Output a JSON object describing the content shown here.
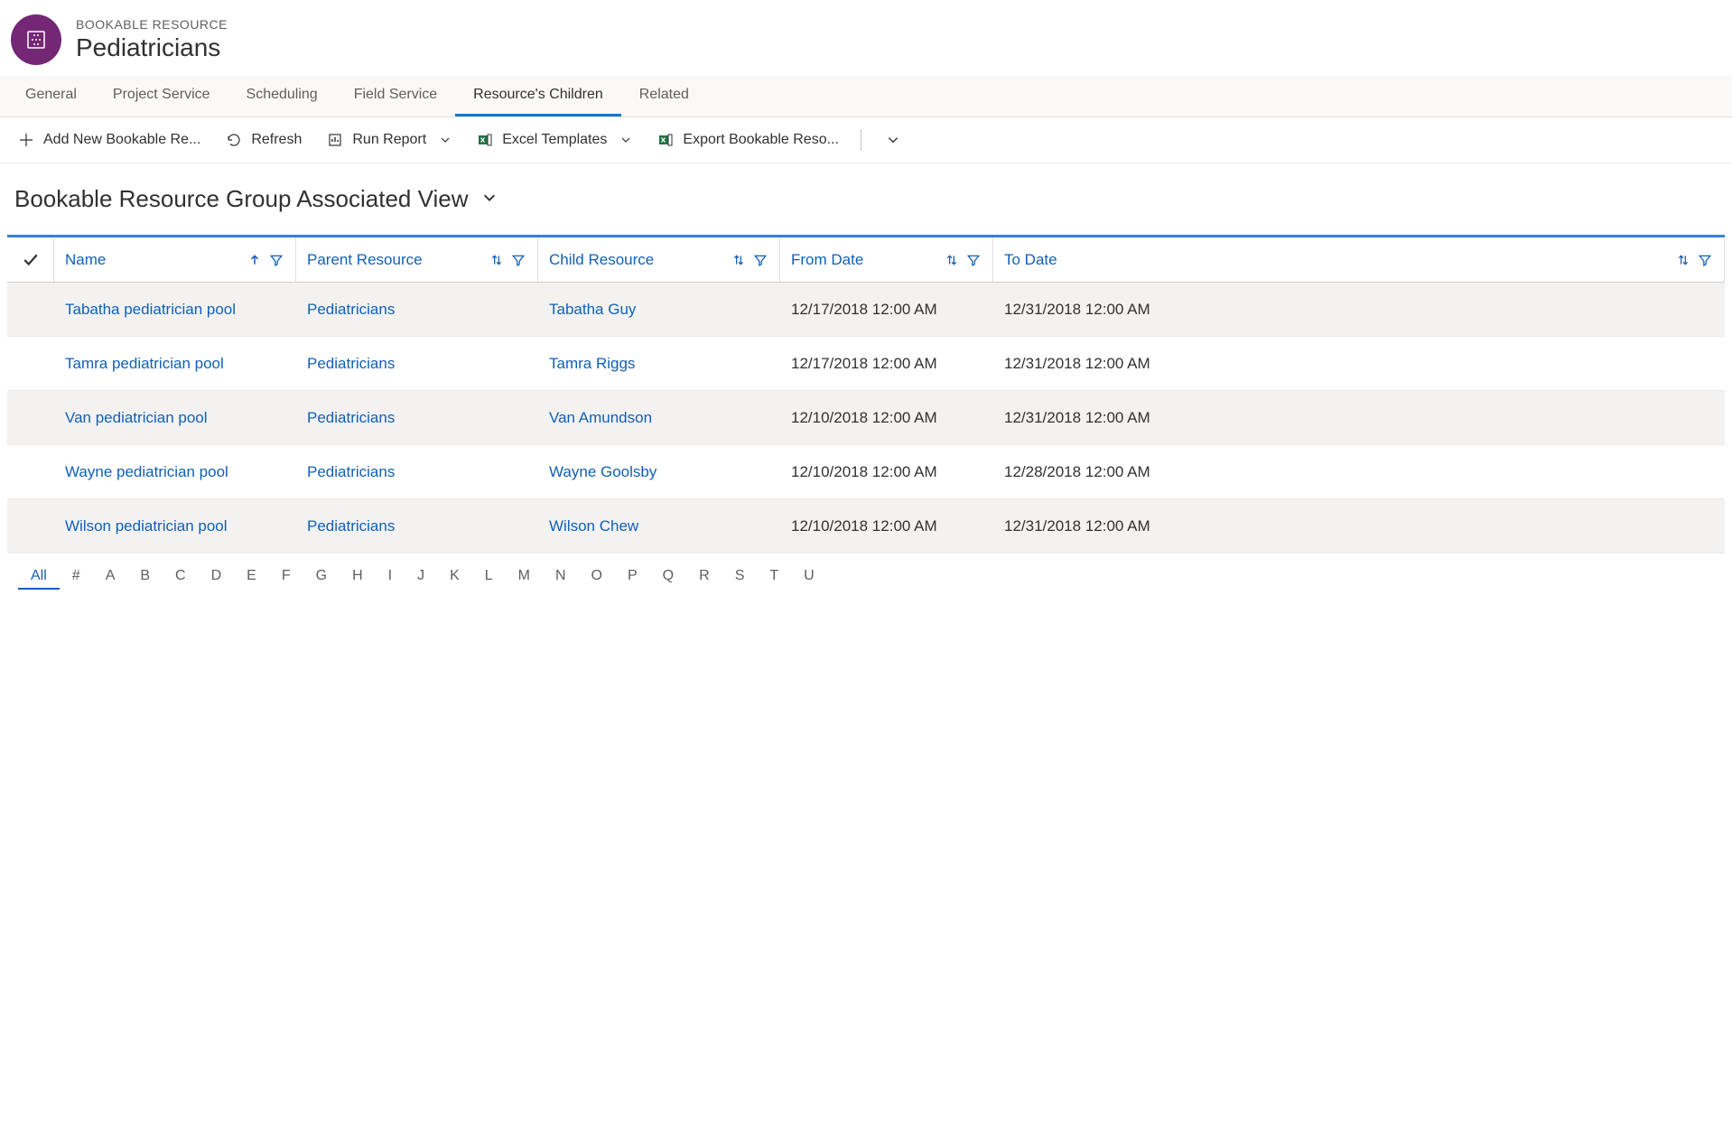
{
  "header": {
    "entity_type": "BOOKABLE RESOURCE",
    "title": "Pediatricians"
  },
  "tabs": [
    {
      "label": "General",
      "active": false
    },
    {
      "label": "Project Service",
      "active": false
    },
    {
      "label": "Scheduling",
      "active": false
    },
    {
      "label": "Field Service",
      "active": false
    },
    {
      "label": "Resource's Children",
      "active": true
    },
    {
      "label": "Related",
      "active": false
    }
  ],
  "toolbar": {
    "add_new": "Add New Bookable Re...",
    "refresh": "Refresh",
    "run_report": "Run Report",
    "excel_templates": "Excel Templates",
    "export": "Export Bookable Reso..."
  },
  "view": {
    "title": "Bookable Resource Group Associated View"
  },
  "grid": {
    "columns": [
      {
        "key": "name",
        "label": "Name"
      },
      {
        "key": "parent",
        "label": "Parent Resource"
      },
      {
        "key": "child",
        "label": "Child Resource"
      },
      {
        "key": "from",
        "label": "From Date"
      },
      {
        "key": "to",
        "label": "To Date"
      }
    ],
    "rows": [
      {
        "name": "Tabatha pediatrician pool",
        "parent": "Pediatricians",
        "child": "Tabatha Guy",
        "from": "12/17/2018 12:00 AM",
        "to": "12/31/2018 12:00 AM"
      },
      {
        "name": "Tamra pediatrician pool",
        "parent": "Pediatricians",
        "child": "Tamra Riggs",
        "from": "12/17/2018 12:00 AM",
        "to": "12/31/2018 12:00 AM"
      },
      {
        "name": "Van pediatrician pool",
        "parent": "Pediatricians",
        "child": "Van Amundson",
        "from": "12/10/2018 12:00 AM",
        "to": "12/31/2018 12:00 AM"
      },
      {
        "name": "Wayne pediatrician pool",
        "parent": "Pediatricians",
        "child": "Wayne Goolsby",
        "from": "12/10/2018 12:00 AM",
        "to": "12/28/2018 12:00 AM"
      },
      {
        "name": "Wilson pediatrician pool",
        "parent": "Pediatricians",
        "child": "Wilson Chew",
        "from": "12/10/2018 12:00 AM",
        "to": "12/31/2018 12:00 AM"
      }
    ]
  },
  "alpha": {
    "items": [
      "All",
      "#",
      "A",
      "B",
      "C",
      "D",
      "E",
      "F",
      "G",
      "H",
      "I",
      "J",
      "K",
      "L",
      "M",
      "N",
      "O",
      "P",
      "Q",
      "R",
      "S",
      "T",
      "U"
    ],
    "active": "All"
  }
}
